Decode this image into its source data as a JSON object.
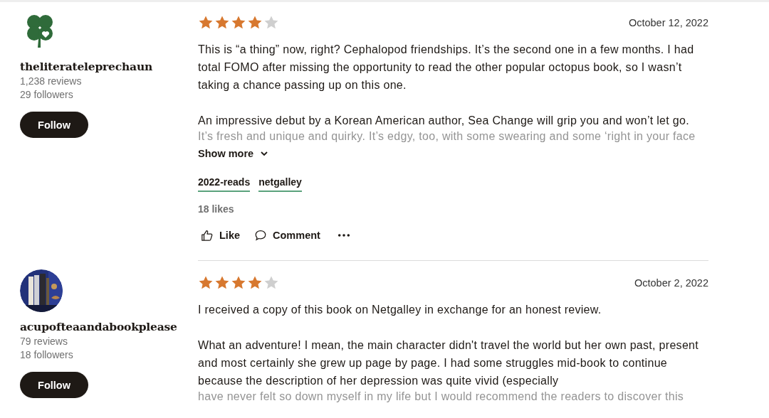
{
  "reviews": [
    {
      "avatar": {
        "kind": "icon"
      },
      "user": {
        "name": "theliterateleprechaun",
        "reviews": "1,238 reviews",
        "followers": "29 followers"
      },
      "follow_label": "Follow",
      "stars": 4,
      "date": "October 12, 2022",
      "paragraphs": [
        "This is “a thing” now, right? Cephalopod friendships. It’s the second one in a few months. I had total FOMO after missing the opportunity to read the other popular octopus book, so I wasn’t taking a chance passing up on this one.",
        "An impressive debut by a Korean American author, Sea Change will grip you and won’t let go."
      ],
      "faded_line": "It’s fresh and unique and quirky. It’s edgy, too, with some swearing and some ‘right in your face",
      "show_more": "Show more",
      "tags": [
        "2022-reads",
        "netgalley"
      ],
      "likes": "18 likes",
      "actions": {
        "like": "Like",
        "comment": "Comment"
      }
    },
    {
      "user": {
        "name": "acupofteaandabookplease",
        "reviews": "79 reviews",
        "followers": "18 followers"
      },
      "follow_label": "Follow",
      "stars": 4,
      "date": "October 2, 2022",
      "paragraphs": [
        "I received a copy of this book on Netgalley in exchange for an honest review.",
        "What an adventure! I mean, the main character didn't travel the world but her own past, present and most certainly she grew up page by page. I had some struggles mid-book to continue because the description of her depression was quite vivid (especially"
      ],
      "faded_line": "have never felt so down myself in my life but I would recommend the readers to discover this"
    }
  ]
}
